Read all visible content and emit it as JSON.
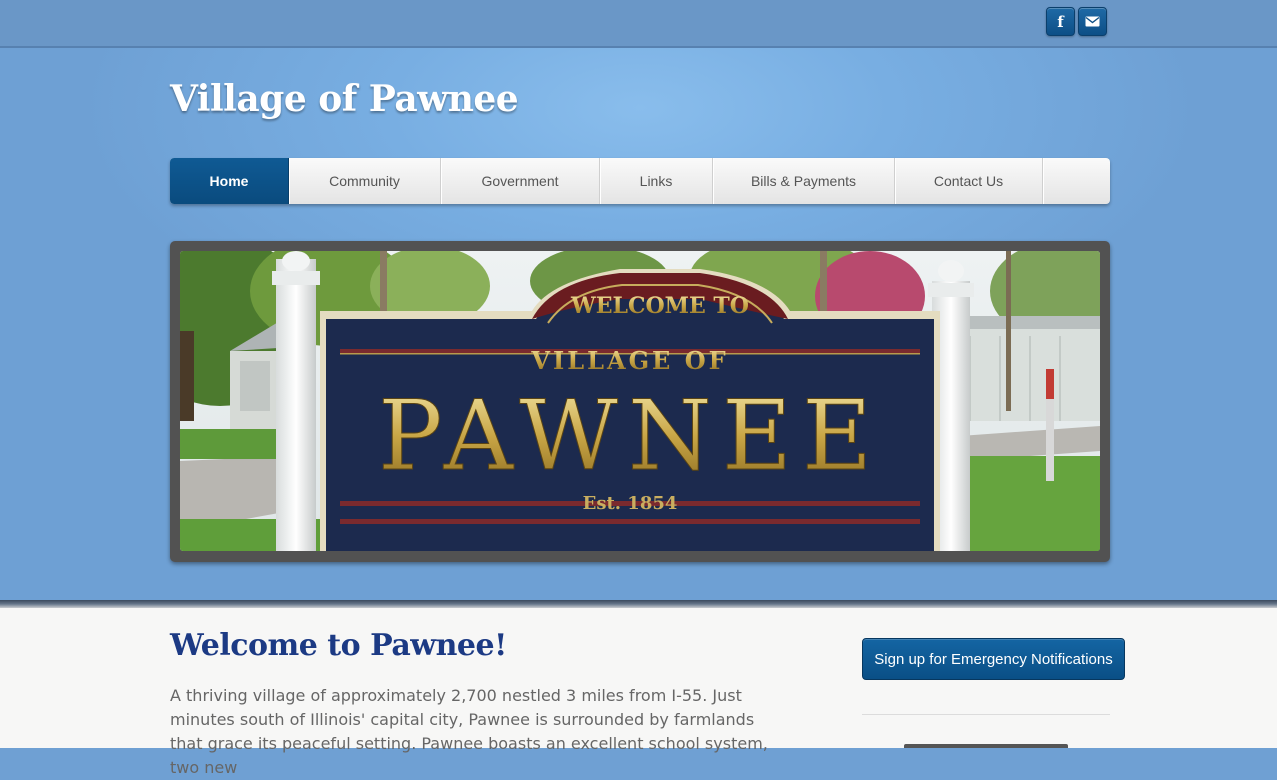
{
  "social": {
    "facebook_glyph": "f",
    "facebook_icon": "facebook-icon",
    "mail_icon": "mail-icon"
  },
  "site": {
    "title": "Village of Pawnee"
  },
  "nav": {
    "items": [
      {
        "label": "Home",
        "active": true
      },
      {
        "label": "Community"
      },
      {
        "label": "Government"
      },
      {
        "label": "Links"
      },
      {
        "label": "Bills & Payments"
      },
      {
        "label": "Contact Us"
      }
    ]
  },
  "banner": {
    "sign": {
      "arch_text": "WELCOME TO",
      "line1": "VILLAGE OF",
      "name": "PAWNEE",
      "established": "Est. 1854"
    }
  },
  "main": {
    "heading": "Welcome to Pawnee!",
    "intro": "A thriving village of approximately 2,700 nestled 3 miles from I-55. Just minutes south of Illinois' capital city, Pawnee is surrounded by farmlands that grace its peaceful setting. Pawnee boasts an excellent school system, two new"
  },
  "sidebar": {
    "emergency_button": "Sign up for Emergency Notifications"
  },
  "colors": {
    "accent": "#0d5a93",
    "heading": "#1c3a84",
    "sky": "#78aee2"
  }
}
